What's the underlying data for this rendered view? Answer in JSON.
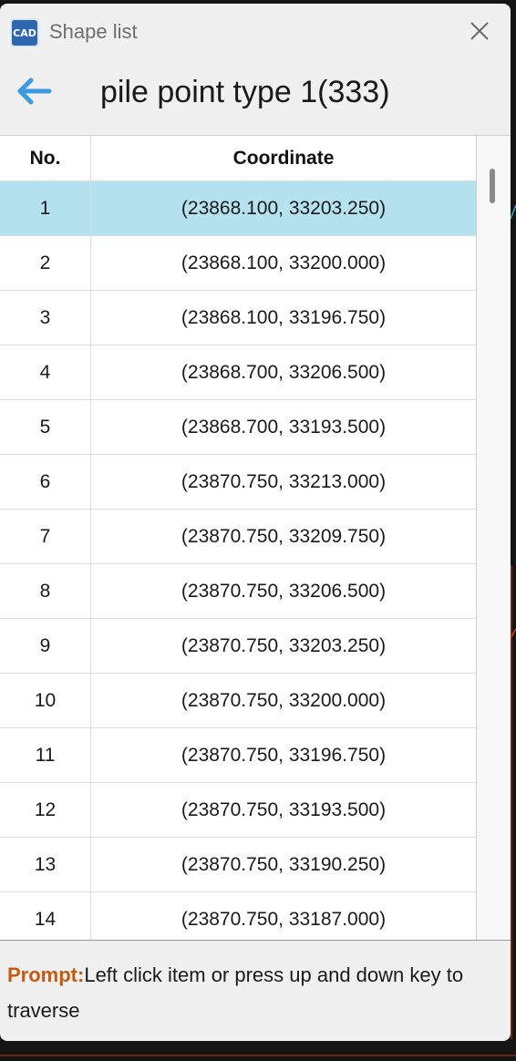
{
  "window": {
    "title": "Shape list",
    "app_icon_text": "CAD"
  },
  "header": {
    "title": "pile point type 1(333)"
  },
  "table": {
    "columns": [
      "No.",
      "Coordinate"
    ],
    "selected_index": 0,
    "rows": [
      {
        "no": "1",
        "coordinate": "(23868.100, 33203.250)"
      },
      {
        "no": "2",
        "coordinate": "(23868.100, 33200.000)"
      },
      {
        "no": "3",
        "coordinate": "(23868.100, 33196.750)"
      },
      {
        "no": "4",
        "coordinate": "(23868.700, 33206.500)"
      },
      {
        "no": "5",
        "coordinate": "(23868.700, 33193.500)"
      },
      {
        "no": "6",
        "coordinate": "(23870.750, 33213.000)"
      },
      {
        "no": "7",
        "coordinate": "(23870.750, 33209.750)"
      },
      {
        "no": "8",
        "coordinate": "(23870.750, 33206.500)"
      },
      {
        "no": "9",
        "coordinate": "(23870.750, 33203.250)"
      },
      {
        "no": "10",
        "coordinate": "(23870.750, 33200.000)"
      },
      {
        "no": "11",
        "coordinate": "(23870.750, 33196.750)"
      },
      {
        "no": "12",
        "coordinate": "(23870.750, 33193.500)"
      },
      {
        "no": "13",
        "coordinate": "(23870.750, 33190.250)"
      },
      {
        "no": "14",
        "coordinate": "(23870.750, 33187.000)"
      }
    ]
  },
  "prompt": {
    "label": "Prompt:",
    "text": "Left click item or press up and down key to traverse"
  },
  "colors": {
    "selected_row": "#b4e2ee",
    "prompt_label": "#c55a11",
    "back_arrow": "#3a9be0"
  }
}
